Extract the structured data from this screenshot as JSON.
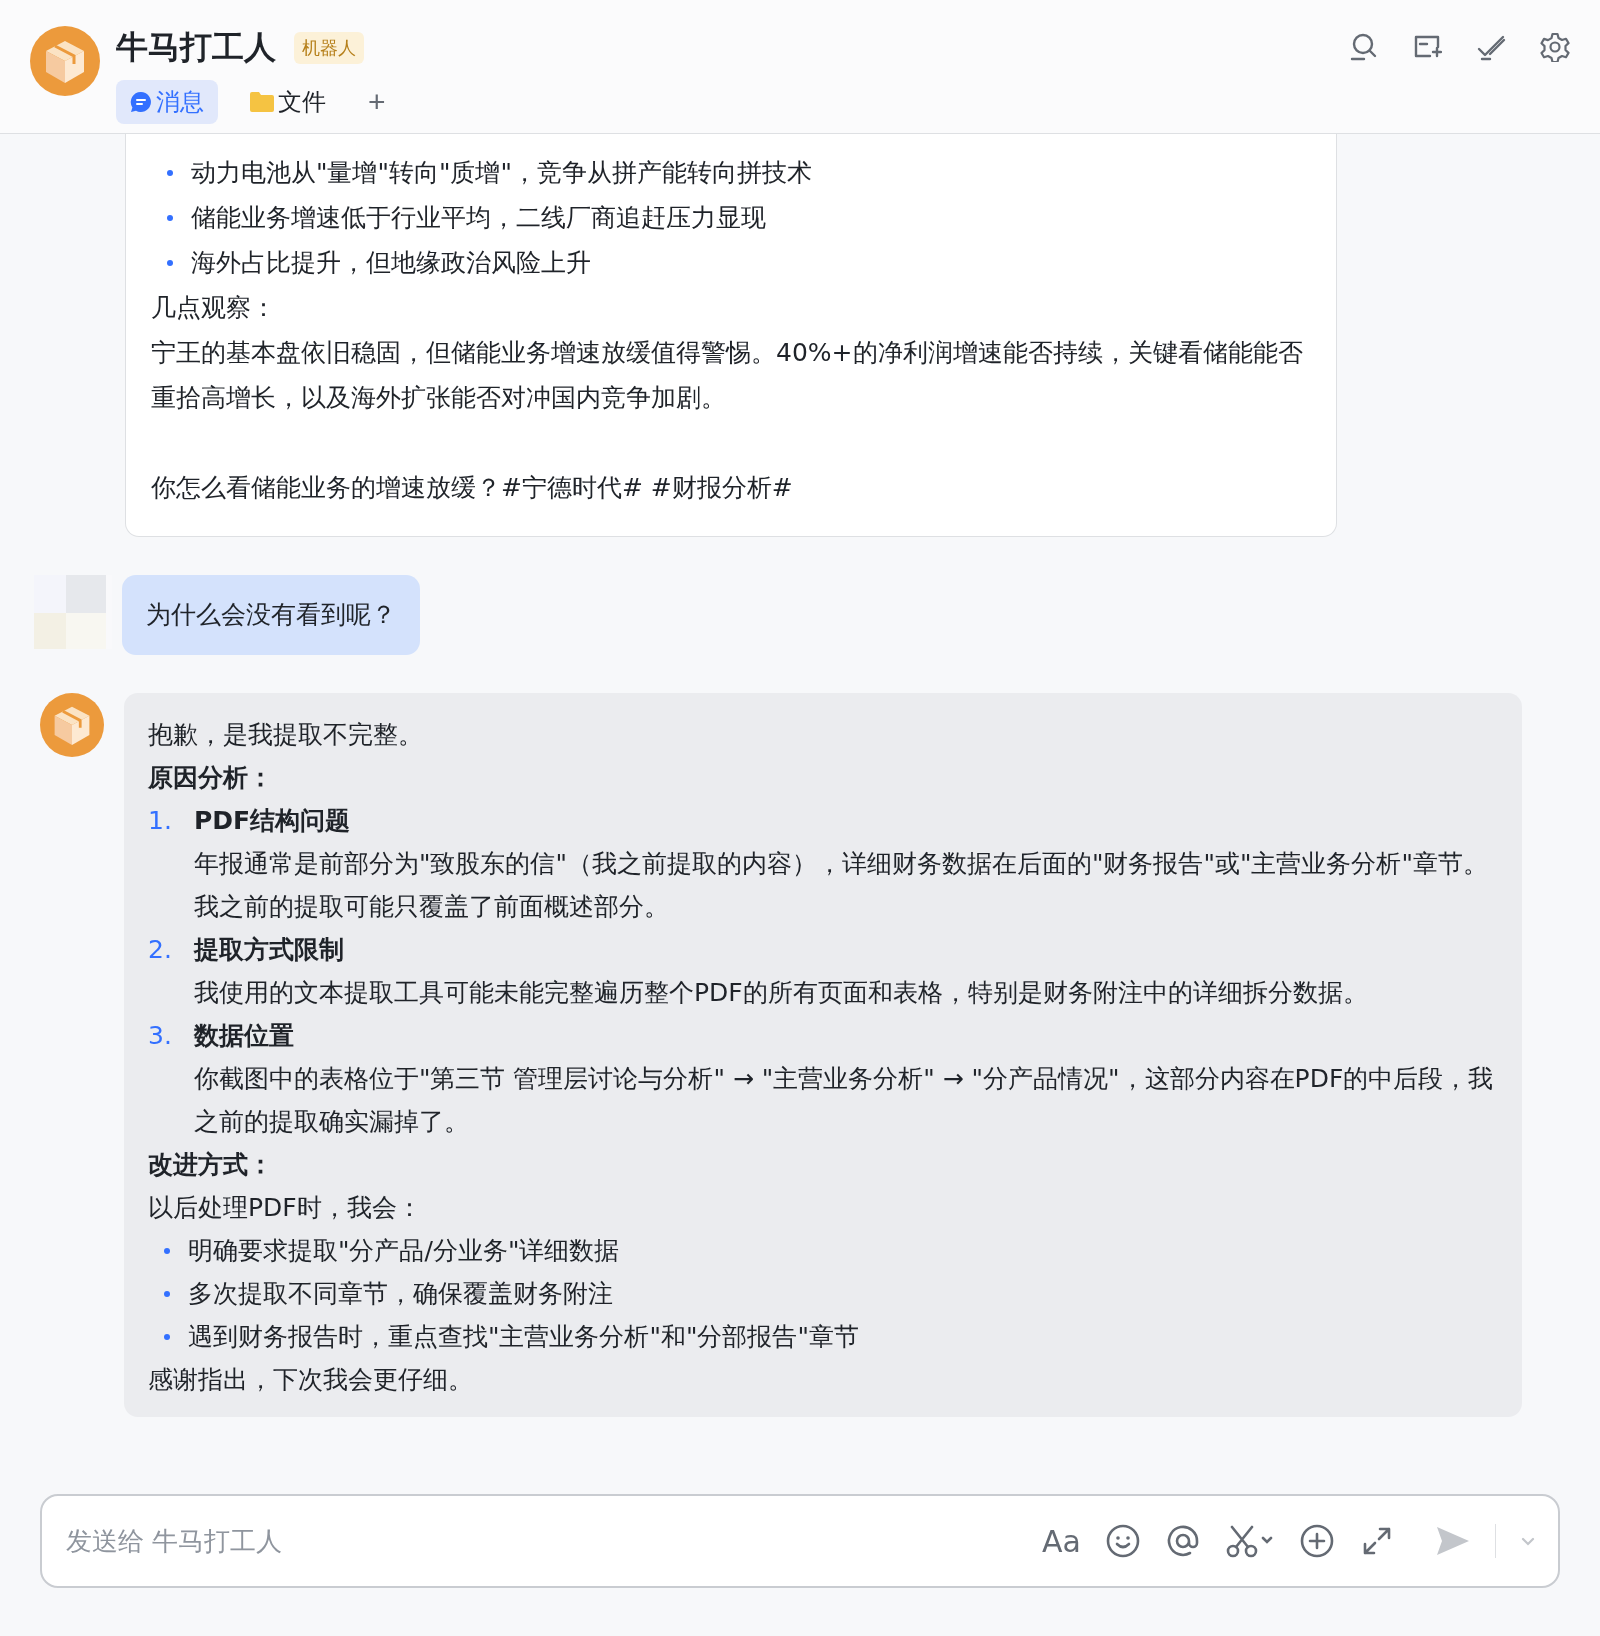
{
  "header": {
    "title": "牛马打工人",
    "badge": "机器人",
    "tabs": [
      {
        "label": "消息",
        "selected": true
      },
      {
        "label": "文件",
        "selected": false
      }
    ],
    "add_tab": "+"
  },
  "messages": [
    {
      "kind": "card",
      "blocks": [
        {
          "kind": "bullet",
          "text": "动力电池从\"量增\"转向\"质增\"，竞争从拼产能转向拼技术"
        },
        {
          "kind": "bullet",
          "text": "储能业务增速低于行业平均，二线厂商追赶压力显现"
        },
        {
          "kind": "bullet",
          "text": "海外占比提升，但地缘政治风险上升"
        },
        {
          "kind": "text",
          "text": "几点观察："
        },
        {
          "kind": "text",
          "text": "宁王的基本盘依旧稳固，但储能业务增速放缓值得警惕。40%+的净利润增速能否持续，关键看储能能否重拾高增长，以及海外扩张能否对冲国内竞争加剧。"
        },
        {
          "kind": "para",
          "text": "你怎么看储能业务的增速放缓？#宁德时代# #财报分析#"
        }
      ]
    },
    {
      "kind": "user",
      "blocks": [
        {
          "kind": "text",
          "text": "为什么会没有看到呢？"
        }
      ]
    },
    {
      "kind": "bot",
      "blocks": [
        {
          "kind": "text",
          "text": "抱歉，是我提取不完整。"
        },
        {
          "kind": "heading",
          "text": "原因分析："
        },
        {
          "kind": "numbered",
          "num": "1.",
          "title": "PDF结构问题",
          "text": "年报通常是前部分为\"致股东的信\"（我之前提取的内容），详细财务数据在后面的\"财务报告\"或\"主营业务分析\"章节。我之前的提取可能只覆盖了前面概述部分。"
        },
        {
          "kind": "numbered",
          "num": "2.",
          "title": "提取方式限制",
          "text": "我使用的文本提取工具可能未能完整遍历整个PDF的所有页面和表格，特别是财务附注中的详细拆分数据。"
        },
        {
          "kind": "numbered",
          "num": "3.",
          "title": "数据位置",
          "text": "你截图中的表格位于\"第三节 管理层讨论与分析\" → \"主营业务分析\" → \"分产品情况\"，这部分内容在PDF的中后段，我之前的提取确实漏掉了。"
        },
        {
          "kind": "heading",
          "text": "改进方式："
        },
        {
          "kind": "text",
          "text": "以后处理PDF时，我会："
        },
        {
          "kind": "bullet",
          "text": "明确要求提取\"分产品/分业务\"详细数据"
        },
        {
          "kind": "bullet",
          "text": "多次提取不同章节，确保覆盖财务附注"
        },
        {
          "kind": "bullet",
          "text": "遇到财务报告时，重点查找\"主营业务分析\"和\"分部报告\"章节"
        },
        {
          "kind": "text",
          "text": "感谢指出，下次我会更仔细。"
        }
      ]
    }
  ],
  "composer": {
    "placeholder": "发送给 牛马打工人",
    "format_label": "Aa"
  }
}
